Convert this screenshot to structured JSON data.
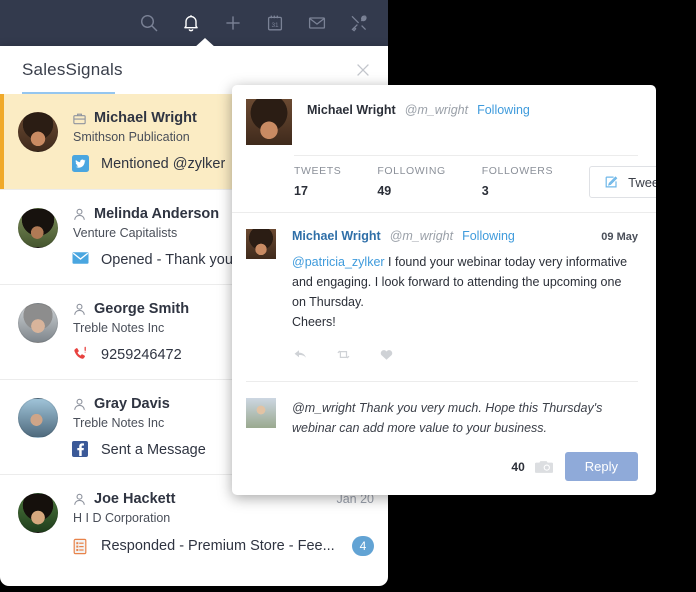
{
  "appbar": {
    "icons": [
      {
        "name": "search-icon",
        "label": "Search",
        "active": false
      },
      {
        "name": "bell-icon",
        "label": "Notifications",
        "active": true
      },
      {
        "name": "plus-icon",
        "label": "Add",
        "active": false
      },
      {
        "name": "calendar-icon",
        "label": "Calendar",
        "active": false,
        "day": "31"
      },
      {
        "name": "envelope-icon",
        "label": "Mail",
        "active": false
      },
      {
        "name": "tools-icon",
        "label": "Setup",
        "active": false
      }
    ],
    "background_color": "#333a4d"
  },
  "panel": {
    "title": "SalesSignals",
    "close_label": "×",
    "accent_color": "#f0a929",
    "tab_indicator_color": "#95c6ef",
    "items": [
      {
        "name": "Michael Wright",
        "company": "Smithson Publication",
        "record_type_icon": "lead-icon",
        "channel_icon": "twitter-icon",
        "action": "Mentioned @zylker",
        "date": "",
        "badge": "",
        "highlighted": true
      },
      {
        "name": "Melinda Anderson",
        "company": "Venture Capitalists",
        "record_type_icon": "contact-icon",
        "channel_icon": "email-icon",
        "action": "Opened - Thank you",
        "date": "",
        "badge": "",
        "highlighted": false
      },
      {
        "name": "George Smith",
        "company": "Treble Notes Inc",
        "record_type_icon": "contact-icon",
        "channel_icon": "missed-call-icon",
        "action": "9259246472",
        "date": "",
        "badge": "",
        "highlighted": false
      },
      {
        "name": "Gray Davis",
        "company": "Treble Notes Inc",
        "record_type_icon": "contact-icon",
        "channel_icon": "facebook-icon",
        "action": "Sent a Message",
        "date": "",
        "badge": "",
        "highlighted": false
      },
      {
        "name": "Joe Hackett",
        "company": "H I D Corporation",
        "record_type_icon": "contact-icon",
        "channel_icon": "survey-icon",
        "action": "Responded - Premium Store - Fee...",
        "date": "Jan 20",
        "badge": "4",
        "highlighted": false
      }
    ]
  },
  "twitter_card": {
    "profile": {
      "name": "Michael Wright",
      "handle": "@m_wright",
      "following_label": "Following"
    },
    "stats": [
      {
        "label": "TWEETS",
        "value": "17"
      },
      {
        "label": "FOLLOWING",
        "value": "49"
      },
      {
        "label": "FOLLOWERS",
        "value": "3"
      }
    ],
    "tweet_button": {
      "label": "Tweet",
      "icon": "compose-pencil-icon"
    },
    "tweet": {
      "name": "Michael Wright",
      "handle": "@m_wright",
      "following_label": "Following",
      "date": "09 May",
      "mention": "@patricia_zylker",
      "body": " I found your webinar today very informative and engaging. I look forward to attending the upcoming one on Thursday.",
      "signoff": "Cheers!",
      "actions": [
        "reply-icon",
        "retweet-icon",
        "like-icon"
      ]
    },
    "reply": {
      "text": "@m_wright Thank you very much. Hope this Thursday's webinar can add more value to your business.",
      "char_count": "40",
      "camera_icon": "camera-icon",
      "button_label": "Reply",
      "button_color": "#8faad9"
    }
  }
}
